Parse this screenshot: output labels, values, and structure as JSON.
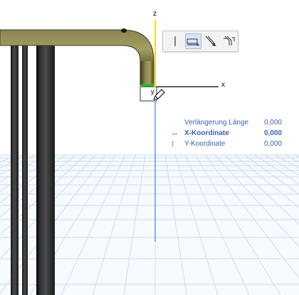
{
  "viewport": {
    "axes": {
      "x_label": "x",
      "y_label": "y",
      "z_label": "z"
    },
    "colors": {
      "z_axis": "#f2e200",
      "y_axis": "#3a7fd6",
      "x_axis": "#000000",
      "green_marker": "#1ac41a",
      "grid": "#c9dcf1",
      "pipe": "#6d6a2d"
    }
  },
  "pet_palette": {
    "buttons": [
      {
        "icon": "vertical-line-icon",
        "active": false
      },
      {
        "icon": "horizontal-edit-icon",
        "active": true
      },
      {
        "icon": "diagonal-arrow-icon",
        "active": false
      },
      {
        "icon": "multi-arrow-icon",
        "active": false
      }
    ]
  },
  "tracker": {
    "rows": [
      {
        "icon": "",
        "label": "Verlängerung Länge",
        "value": "0,000"
      },
      {
        "icon": "↔",
        "label": "X-Koordinate",
        "value": "0,000",
        "bold": true
      },
      {
        "icon": "↕",
        "label": "Y-Koordinate",
        "value": "0,000"
      }
    ]
  }
}
